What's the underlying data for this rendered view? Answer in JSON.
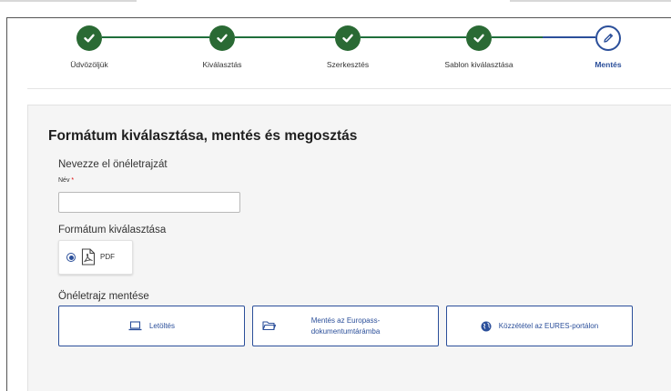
{
  "stepper": {
    "steps": [
      {
        "label": "Üdvözöljük",
        "state": "done",
        "icon": "check-icon"
      },
      {
        "label": "Kiválasztás",
        "state": "done",
        "icon": "check-icon"
      },
      {
        "label": "Szerkesztés",
        "state": "done",
        "icon": "check-icon"
      },
      {
        "label": "Sablon kiválasztása",
        "state": "done",
        "icon": "check-icon"
      },
      {
        "label": "Mentés",
        "state": "current",
        "icon": "pencil-icon"
      }
    ]
  },
  "form": {
    "title": "Formátum kiválasztása, mentés és megosztás",
    "name_section": "Nevezze el önéletrajzát",
    "name_label": "Név",
    "required_mark": "*",
    "name_value": "",
    "format_section": "Formátum kiválasztása",
    "format_option": {
      "label": "PDF",
      "selected": true,
      "icon": "pdf-file-icon"
    },
    "save_section": "Önéletrajz mentése",
    "actions": [
      {
        "label": "Letöltés",
        "icon": "laptop-icon"
      },
      {
        "label": "Mentés az Europass-dokumentumtárámba",
        "line1": "Mentés az Europass-",
        "line2": "dokumentumtárámba",
        "icon": "folder-icon"
      },
      {
        "label": "Közzététel az EURES-portálon",
        "icon": "globe-icon"
      }
    ]
  },
  "colors": {
    "done": "#2a6a34",
    "accent": "#2b4f9a",
    "panel": "#f5f5f5"
  }
}
